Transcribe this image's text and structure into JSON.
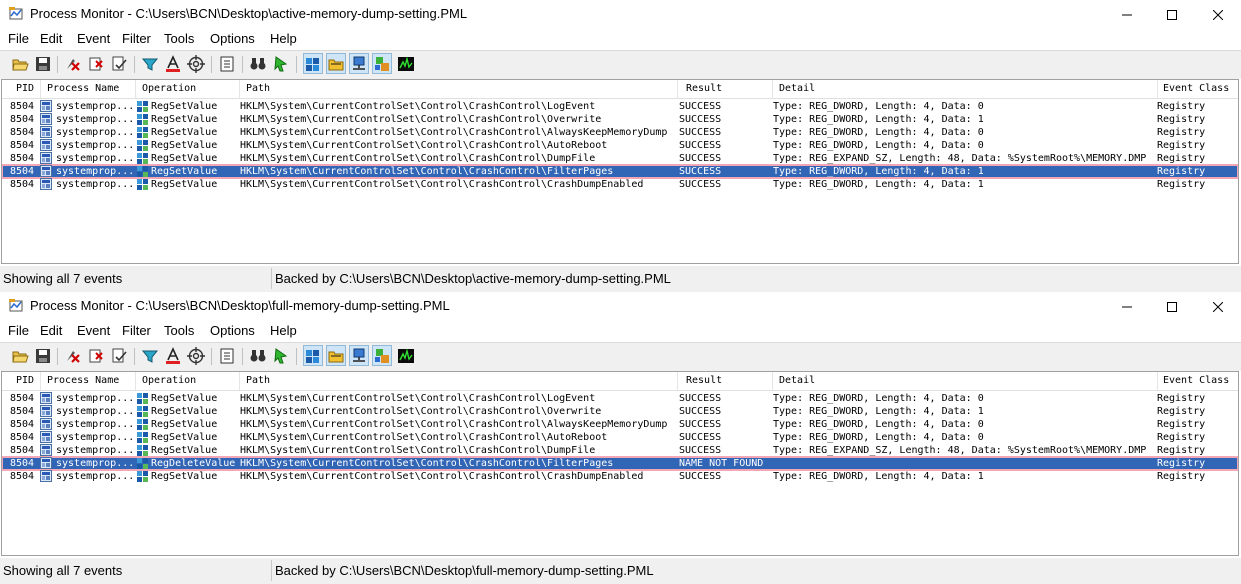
{
  "menu": [
    "File",
    "Edit",
    "Event",
    "Filter",
    "Tools",
    "Options",
    "Help"
  ],
  "columns": {
    "pid": "PID",
    "process_name": "Process Name",
    "operation": "Operation",
    "path": "Path",
    "result": "Result",
    "detail": "Detail",
    "event_class": "Event Class"
  },
  "toolbar_icons": [
    "open-icon",
    "save-icon",
    "capture-icon",
    "autoscroll-icon",
    "clear-icon",
    "filter-icon",
    "highlight-icon",
    "target-icon",
    "process-tree-icon",
    "find-icon",
    "jump-icon",
    "registry-activity-icon",
    "file-activity-icon",
    "network-activity-icon",
    "process-activity-icon",
    "profiling-icon"
  ],
  "colors": {
    "selection": "#3165b5",
    "selection_outline": "#f2a6b6"
  },
  "windows": [
    {
      "title": "Process Monitor - C:\\Users\\BCN\\Desktop\\active-memory-dump-setting.PML",
      "status_left": "Showing all 7 events",
      "status_right": "Backed by C:\\Users\\BCN\\Desktop\\active-memory-dump-setting.PML",
      "rows": [
        {
          "pid": "8504",
          "process": "systemprop...",
          "operation": "RegSetValue",
          "path": "HKLM\\System\\CurrentControlSet\\Control\\CrashControl\\LogEvent",
          "result": "SUCCESS",
          "detail": "Type: REG_DWORD, Length: 4, Data: 0",
          "event_class": "Registry",
          "selected": false
        },
        {
          "pid": "8504",
          "process": "systemprop...",
          "operation": "RegSetValue",
          "path": "HKLM\\System\\CurrentControlSet\\Control\\CrashControl\\Overwrite",
          "result": "SUCCESS",
          "detail": "Type: REG_DWORD, Length: 4, Data: 1",
          "event_class": "Registry",
          "selected": false
        },
        {
          "pid": "8504",
          "process": "systemprop...",
          "operation": "RegSetValue",
          "path": "HKLM\\System\\CurrentControlSet\\Control\\CrashControl\\AlwaysKeepMemoryDump",
          "result": "SUCCESS",
          "detail": "Type: REG_DWORD, Length: 4, Data: 0",
          "event_class": "Registry",
          "selected": false
        },
        {
          "pid": "8504",
          "process": "systemprop...",
          "operation": "RegSetValue",
          "path": "HKLM\\System\\CurrentControlSet\\Control\\CrashControl\\AutoReboot",
          "result": "SUCCESS",
          "detail": "Type: REG_DWORD, Length: 4, Data: 0",
          "event_class": "Registry",
          "selected": false
        },
        {
          "pid": "8504",
          "process": "systemprop...",
          "operation": "RegSetValue",
          "path": "HKLM\\System\\CurrentControlSet\\Control\\CrashControl\\DumpFile",
          "result": "SUCCESS",
          "detail": "Type: REG_EXPAND_SZ, Length: 48, Data: %SystemRoot%\\MEMORY.DMP",
          "event_class": "Registry",
          "selected": false
        },
        {
          "pid": "8504",
          "process": "systemprop...",
          "operation": "RegSetValue",
          "path": "HKLM\\System\\CurrentControlSet\\Control\\CrashControl\\FilterPages",
          "result": "SUCCESS",
          "detail": "Type: REG_DWORD, Length: 4, Data: 1",
          "event_class": "Registry",
          "selected": true
        },
        {
          "pid": "8504",
          "process": "systemprop...",
          "operation": "RegSetValue",
          "path": "HKLM\\System\\CurrentControlSet\\Control\\CrashControl\\CrashDumpEnabled",
          "result": "SUCCESS",
          "detail": "Type: REG_DWORD, Length: 4, Data: 1",
          "event_class": "Registry",
          "selected": false
        }
      ]
    },
    {
      "title": "Process Monitor - C:\\Users\\BCN\\Desktop\\full-memory-dump-setting.PML",
      "status_left": "Showing all 7 events",
      "status_right": "Backed by C:\\Users\\BCN\\Desktop\\full-memory-dump-setting.PML",
      "rows": [
        {
          "pid": "8504",
          "process": "systemprop...",
          "operation": "RegSetValue",
          "path": "HKLM\\System\\CurrentControlSet\\Control\\CrashControl\\LogEvent",
          "result": "SUCCESS",
          "detail": "Type: REG_DWORD, Length: 4, Data: 0",
          "event_class": "Registry",
          "selected": false
        },
        {
          "pid": "8504",
          "process": "systemprop...",
          "operation": "RegSetValue",
          "path": "HKLM\\System\\CurrentControlSet\\Control\\CrashControl\\Overwrite",
          "result": "SUCCESS",
          "detail": "Type: REG_DWORD, Length: 4, Data: 1",
          "event_class": "Registry",
          "selected": false
        },
        {
          "pid": "8504",
          "process": "systemprop...",
          "operation": "RegSetValue",
          "path": "HKLM\\System\\CurrentControlSet\\Control\\CrashControl\\AlwaysKeepMemoryDump",
          "result": "SUCCESS",
          "detail": "Type: REG_DWORD, Length: 4, Data: 0",
          "event_class": "Registry",
          "selected": false
        },
        {
          "pid": "8504",
          "process": "systemprop...",
          "operation": "RegSetValue",
          "path": "HKLM\\System\\CurrentControlSet\\Control\\CrashControl\\AutoReboot",
          "result": "SUCCESS",
          "detail": "Type: REG_DWORD, Length: 4, Data: 0",
          "event_class": "Registry",
          "selected": false
        },
        {
          "pid": "8504",
          "process": "systemprop...",
          "operation": "RegSetValue",
          "path": "HKLM\\System\\CurrentControlSet\\Control\\CrashControl\\DumpFile",
          "result": "SUCCESS",
          "detail": "Type: REG_EXPAND_SZ, Length: 48, Data: %SystemRoot%\\MEMORY.DMP",
          "event_class": "Registry",
          "selected": false
        },
        {
          "pid": "8504",
          "process": "systemprop...",
          "operation": "RegDeleteValue",
          "path": "HKLM\\System\\CurrentControlSet\\Control\\CrashControl\\FilterPages",
          "result": "NAME NOT FOUND",
          "detail": "",
          "event_class": "Registry",
          "selected": true
        },
        {
          "pid": "8504",
          "process": "systemprop...",
          "operation": "RegSetValue",
          "path": "HKLM\\System\\CurrentControlSet\\Control\\CrashControl\\CrashDumpEnabled",
          "result": "SUCCESS",
          "detail": "Type: REG_DWORD, Length: 4, Data: 1",
          "event_class": "Registry",
          "selected": false
        }
      ]
    }
  ]
}
